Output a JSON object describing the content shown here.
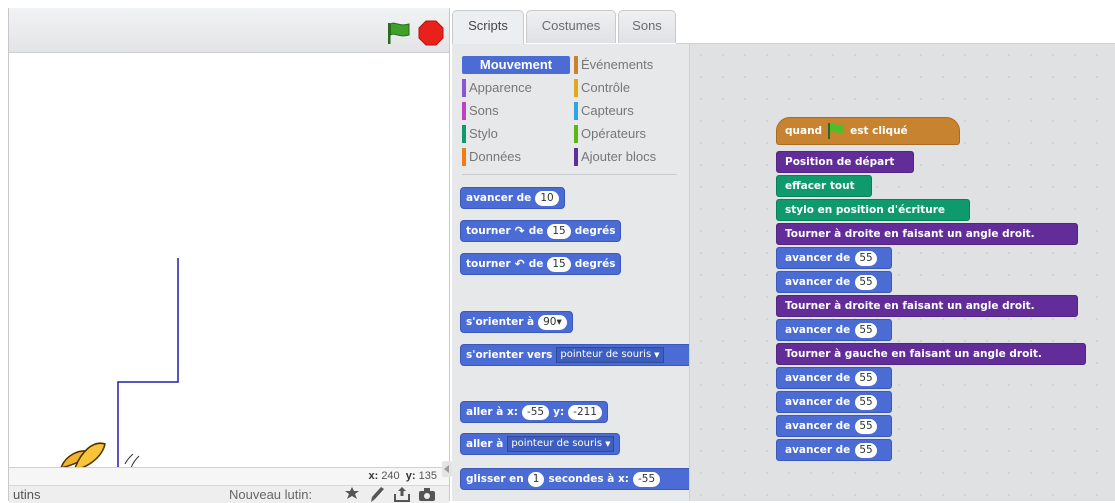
{
  "stage": {
    "coords": {
      "x_label": "x:",
      "x_value": "240",
      "y_label": "y:",
      "y_value": "135"
    },
    "sprites_label": "utins",
    "new_sprite_label": "Nouveau lutin:",
    "pen_path_note": ""
  },
  "tabs": [
    {
      "label": "Scripts",
      "active": true
    },
    {
      "label": "Costumes",
      "active": false
    },
    {
      "label": "Sons",
      "active": false
    }
  ],
  "palette": {
    "categories": [
      {
        "label": "Mouvement",
        "color": "#4a6cd4",
        "selected": true
      },
      {
        "label": "Événements",
        "color": "#c88330"
      },
      {
        "label": "Apparence",
        "color": "#8a55d7"
      },
      {
        "label": "Contrôle",
        "color": "#e1a91a"
      },
      {
        "label": "Sons",
        "color": "#bb42c3"
      },
      {
        "label": "Capteurs",
        "color": "#2ca5e2"
      },
      {
        "label": "Stylo",
        "color": "#0e9a6c"
      },
      {
        "label": "Opérateurs",
        "color": "#5cb712"
      },
      {
        "label": "Données",
        "color": "#ee7d16"
      },
      {
        "label": "Ajouter blocs",
        "color": "#632d99"
      }
    ],
    "blocks": {
      "avancer": {
        "label": "avancer de",
        "value": "10"
      },
      "tourner_right": {
        "label": "tourner",
        "mid": "de",
        "value": "15",
        "unit": "degrés"
      },
      "tourner_left": {
        "label": "tourner",
        "mid": "de",
        "value": "15",
        "unit": "degrés"
      },
      "orienter": {
        "label": "s'orienter à",
        "value": "90"
      },
      "orienter_vers": {
        "label": "s'orienter vers",
        "option": "pointeur de souris"
      },
      "aller_xy": {
        "label": "aller à x:",
        "x": "-55",
        "y_label": "y:",
        "y": "-211"
      },
      "aller_a": {
        "label": "aller à",
        "option": "pointeur de souris"
      },
      "glisser": {
        "label": "glisser en",
        "value": "1",
        "mid": "secondes à x:",
        "x": "-55"
      }
    }
  },
  "script": {
    "hat": {
      "label_before": "quand",
      "label_after": "est cliqué"
    },
    "blocks": [
      {
        "type": "more",
        "text": "Position de départ"
      },
      {
        "type": "pen",
        "text": "effacer tout"
      },
      {
        "type": "pen",
        "text": "stylo en position d'écriture"
      },
      {
        "type": "more",
        "text": "Tourner à droite en faisant un angle droit."
      },
      {
        "type": "motion",
        "text": "avancer de",
        "value": "55"
      },
      {
        "type": "motion",
        "text": "avancer de",
        "value": "55"
      },
      {
        "type": "more",
        "text": "Tourner à droite en faisant un angle droit."
      },
      {
        "type": "motion",
        "text": "avancer de",
        "value": "55"
      },
      {
        "type": "more",
        "text": "Tourner à gauche en faisant un angle droit."
      },
      {
        "type": "motion",
        "text": "avancer de",
        "value": "55"
      },
      {
        "type": "motion",
        "text": "avancer de",
        "value": "55"
      },
      {
        "type": "motion",
        "text": "avancer de",
        "value": "55"
      },
      {
        "type": "motion",
        "text": "avancer de",
        "value": "55"
      }
    ]
  }
}
